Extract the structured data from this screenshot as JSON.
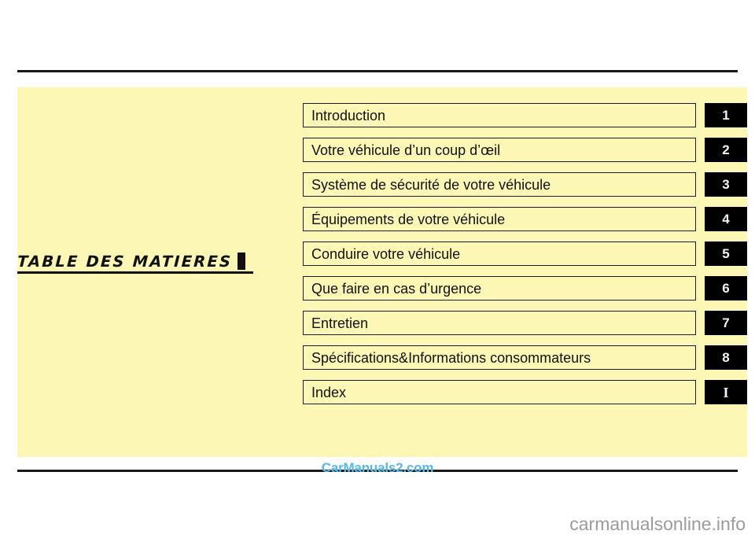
{
  "document": {
    "heading": "TABLE  DES  MATIERES",
    "panel_color": "#fcf7b5",
    "rule_color": "#1a1a1a"
  },
  "chapters": [
    {
      "label": "Introduction",
      "tab": "1",
      "tab_style": "sans"
    },
    {
      "label": "Votre véhicule d’un coup d’œil",
      "tab": "2",
      "tab_style": "sans"
    },
    {
      "label": "Système de sécurité de votre véhicule",
      "tab": "3",
      "tab_style": "sans"
    },
    {
      "label": "Équipements de votre véhicule",
      "tab": "4",
      "tab_style": "sans"
    },
    {
      "label": "Conduire votre véhicule",
      "tab": "5",
      "tab_style": "sans"
    },
    {
      "label": "Que faire en cas d’urgence",
      "tab": "6",
      "tab_style": "sans"
    },
    {
      "label": "Entretien",
      "tab": "7",
      "tab_style": "sans"
    },
    {
      "label": "Spécifications&Informations consommateurs",
      "tab": "8",
      "tab_style": "sans"
    },
    {
      "label": "Index",
      "tab": "I",
      "tab_style": "serif"
    }
  ],
  "watermarks": {
    "center": "CarManuals2.com",
    "center_color": "#56b9ec",
    "corner": "carmanualsonline.info",
    "corner_color": "#9b9b9b"
  }
}
